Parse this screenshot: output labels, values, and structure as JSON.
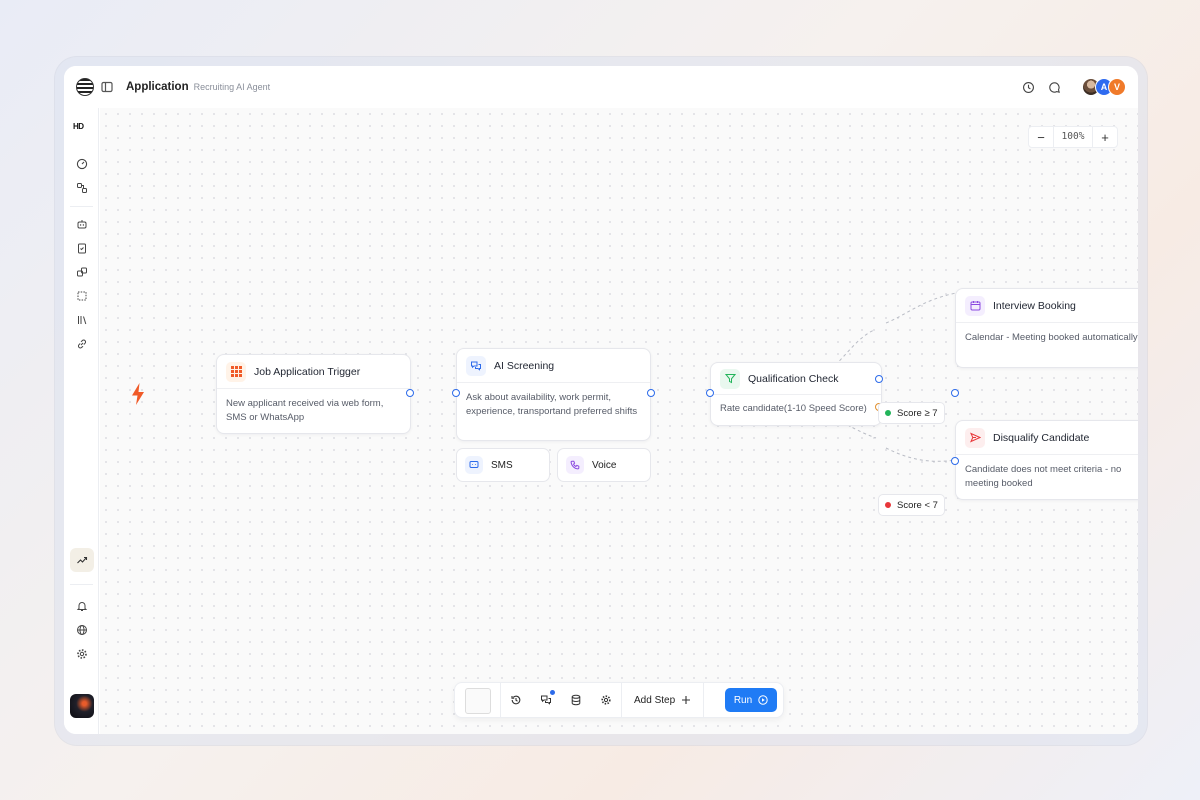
{
  "header": {
    "title": "Application",
    "subtitle": "Recruiting AI Agent",
    "avatars": [
      "A",
      "V"
    ]
  },
  "sidebar": {
    "brand": "HD"
  },
  "zoom": {
    "minus": "−",
    "level": "100%",
    "plus": "+"
  },
  "nodes": {
    "trigger": {
      "title": "Job Application Trigger",
      "body": "New applicant received via web form, SMS or WhatsApp"
    },
    "screening": {
      "title": "AI Screening",
      "body": "Ask about availability, work permit, experience, transportand preferred shifts"
    },
    "sms": {
      "label": "SMS"
    },
    "voice": {
      "label": "Voice"
    },
    "qualification": {
      "title": "Qualification Check",
      "body": "Rate candidate(1-10 Speed Score)"
    },
    "interview": {
      "title": "Interview Booking",
      "body": "Calendar - Meeting booked automatically"
    },
    "disqualify": {
      "title": "Disqualify Candidate",
      "body": "Candidate does not meet criteria - no meeting booked"
    }
  },
  "branches": {
    "high": "Score ≥ 7",
    "low": "Score < 7"
  },
  "toolbar": {
    "add_step": "Add Step",
    "run": "Run"
  },
  "colors": {
    "accent": "#1f7bf5",
    "port": "#2d6bea",
    "trigger": "#f05a28",
    "high": "#22b45a",
    "low": "#e8373a"
  }
}
